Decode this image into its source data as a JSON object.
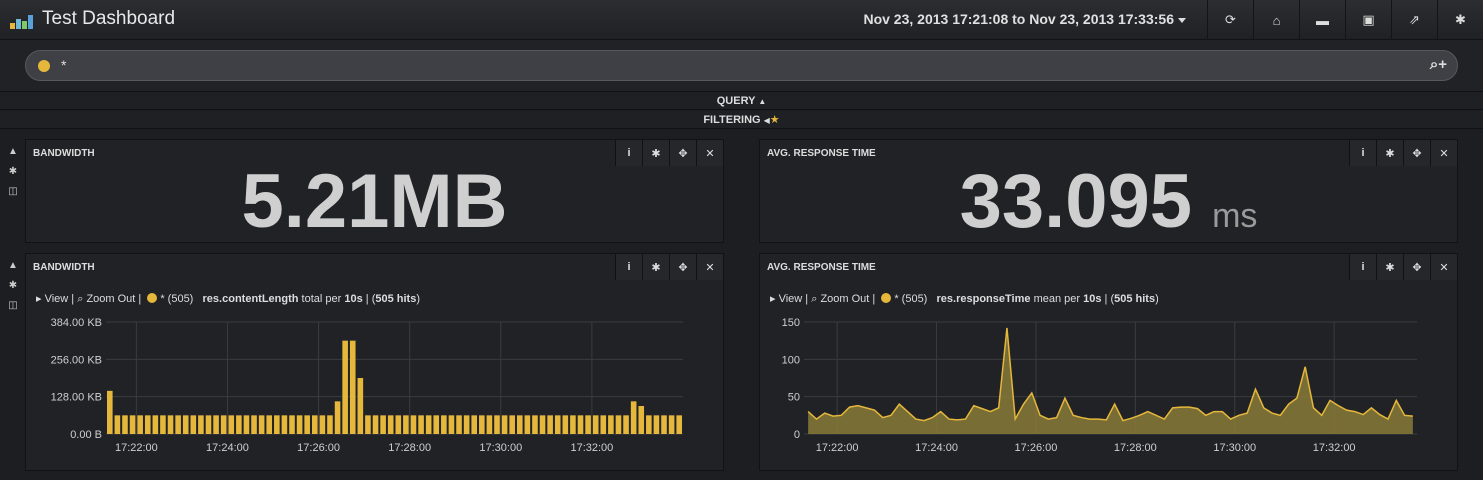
{
  "app": {
    "title": "Test Dashboard",
    "timerange": "Nov 23, 2013 17:21:08 to Nov 23, 2013 17:33:56"
  },
  "nav": {
    "icons": [
      "refresh-icon",
      "home-icon",
      "folder-open-icon",
      "save-icon",
      "share-icon",
      "gear-icon"
    ]
  },
  "query": {
    "value": "*",
    "color": "#e5b73b"
  },
  "strips": {
    "query": "QUERY",
    "filtering": "FILTERING"
  },
  "panels": {
    "bandwidth_stat": {
      "title": "BANDWIDTH",
      "value": "5.21MB"
    },
    "response_stat": {
      "title": "AVG. RESPONSE TIME",
      "value": "33.095",
      "unit": "ms"
    },
    "bandwidth_hist": {
      "title": "BANDWIDTH",
      "view": "View",
      "zoom": "Zoom Out",
      "series_label": "* (505)",
      "field": "res.contentLength",
      "mode": "total per",
      "interval": "10s",
      "hits_prefix": "| (",
      "hits": "505 hits",
      "hits_suffix": ")"
    },
    "response_hist": {
      "title": "AVG. RESPONSE TIME",
      "view": "View",
      "zoom": "Zoom Out",
      "series_label": "* (505)",
      "field": "res.responseTime",
      "mode": "mean per",
      "interval": "10s",
      "hits_prefix": "| (",
      "hits": "505 hits",
      "hits_suffix": ")"
    }
  },
  "chart_data": [
    {
      "type": "bar",
      "title": "BANDWIDTH",
      "ylabel": "",
      "xlabel": "",
      "yticks": [
        "0.00 B",
        "128.00 KB",
        "256.00 KB",
        "384.00 KB"
      ],
      "ytick_values": [
        0,
        128,
        256,
        384
      ],
      "ylim": [
        0,
        384
      ],
      "xticks": [
        "17:22:00",
        "17:24:00",
        "17:26:00",
        "17:28:00",
        "17:30:00",
        "17:32:00"
      ],
      "x_start": "17:21:20",
      "x_end": "17:33:50",
      "x_step_seconds": 10,
      "color": "#e5b73b",
      "values_kb": [
        148,
        64,
        64,
        64,
        64,
        64,
        64,
        64,
        64,
        64,
        64,
        64,
        64,
        64,
        64,
        64,
        64,
        64,
        64,
        64,
        64,
        64,
        64,
        64,
        64,
        64,
        64,
        64,
        64,
        64,
        64,
        64,
        64,
        64,
        64,
        64,
        64,
        64,
        64,
        64,
        64,
        64,
        64,
        64,
        64,
        64,
        64,
        64,
        64,
        64,
        64,
        64,
        64,
        64,
        64,
        64,
        64,
        64,
        64,
        64,
        64,
        64,
        64,
        64,
        64,
        64,
        64,
        64,
        64,
        64,
        64,
        64,
        64,
        64,
        64,
        64
      ],
      "overrides": [
        [
          30,
          64
        ],
        [
          31,
          118
        ],
        [
          32,
          322
        ],
        [
          33,
          322
        ],
        [
          34,
          192
        ],
        [
          35,
          64
        ],
        [
          74,
          64
        ],
        [
          75,
          64
        ],
        [
          76,
          64
        ]
      ],
      "spikes": [
        [
          30,
          112
        ],
        [
          31,
          320
        ],
        [
          32,
          320
        ],
        [
          33,
          192
        ],
        [
          69,
          112
        ],
        [
          70,
          96
        ]
      ]
    },
    {
      "type": "area",
      "title": "AVG. RESPONSE TIME",
      "ylabel": "",
      "xlabel": "",
      "yticks": [
        "0",
        "50",
        "100",
        "150"
      ],
      "ytick_values": [
        0,
        50,
        100,
        150
      ],
      "ylim": [
        0,
        150
      ],
      "xticks": [
        "17:22:00",
        "17:24:00",
        "17:26:00",
        "17:28:00",
        "17:30:00",
        "17:32:00"
      ],
      "x_start": "17:21:20",
      "x_end": "17:33:50",
      "x_step_seconds": 10,
      "color": "#e5b73b",
      "values": [
        30,
        20,
        28,
        24,
        25,
        36,
        38,
        35,
        32,
        22,
        25,
        40,
        30,
        20,
        18,
        22,
        30,
        20,
        19,
        20,
        38,
        34,
        30,
        35,
        142,
        20,
        40,
        55,
        25,
        20,
        22,
        48,
        25,
        22,
        20,
        20,
        19,
        40,
        18,
        21,
        25,
        30,
        25,
        20,
        35,
        36,
        36,
        34,
        25,
        30,
        30,
        20,
        25,
        28,
        60,
        35,
        28,
        25,
        40,
        48,
        90,
        35,
        25,
        45,
        38,
        32,
        30,
        26,
        35,
        26,
        20,
        45,
        25,
        24
      ]
    }
  ]
}
